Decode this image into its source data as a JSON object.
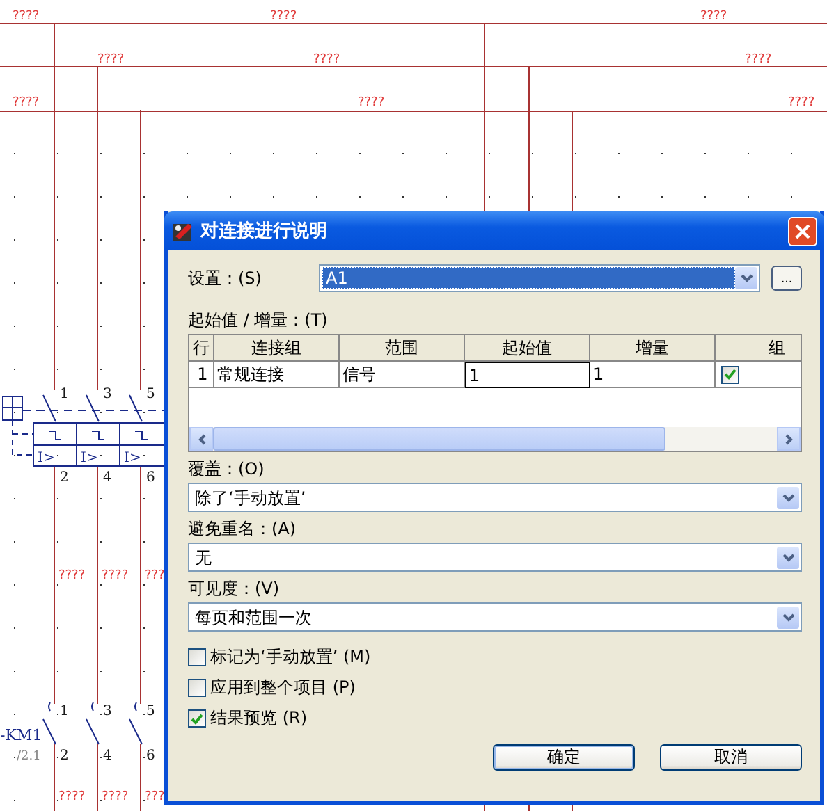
{
  "schematic": {
    "wire_labels": [
      "????",
      "????",
      "????",
      "????",
      "????",
      "????",
      "????",
      "????",
      "????"
    ],
    "lower_wire_labels": [
      "????",
      "????",
      "???",
      "????",
      "????",
      "???"
    ],
    "terminal_numbers": [
      "1",
      "3",
      "5",
      "2",
      "4",
      "6",
      "1",
      "3",
      "5",
      "2",
      "4",
      "6"
    ],
    "trip_labels": [
      "I>",
      "I>",
      "I>"
    ],
    "device_tag": "-KM1",
    "device_reference": "/2.1"
  },
  "dialog": {
    "title": "对连接进行说明",
    "settings": {
      "label": "设置：(S)",
      "value": "A1",
      "highlighted": true,
      "browse_button": "..."
    },
    "table": {
      "label": "起始值 / 增量：(T)",
      "columns": [
        "行",
        "连接组",
        "范围",
        "起始值",
        "增量",
        "组"
      ],
      "rows": [
        {
          "cells": [
            "1",
            "常规连接",
            "信号",
            "1",
            "1"
          ],
          "group_checked": true
        }
      ]
    },
    "dropdowns": [
      {
        "label": "覆盖：(O)",
        "value": "除了‘手动放置’"
      },
      {
        "label": "避免重名：(A)",
        "value": "无"
      },
      {
        "label": "可见度：(V)",
        "value": "每页和范围一次"
      }
    ],
    "checkboxes": [
      {
        "label": "标记为‘手动放置’ (M)",
        "checked": false
      },
      {
        "label": "应用到整个项目 (P)",
        "checked": false
      },
      {
        "label": "结果预览 (R)",
        "checked": true
      }
    ],
    "buttons": [
      "确定",
      "取消"
    ]
  }
}
